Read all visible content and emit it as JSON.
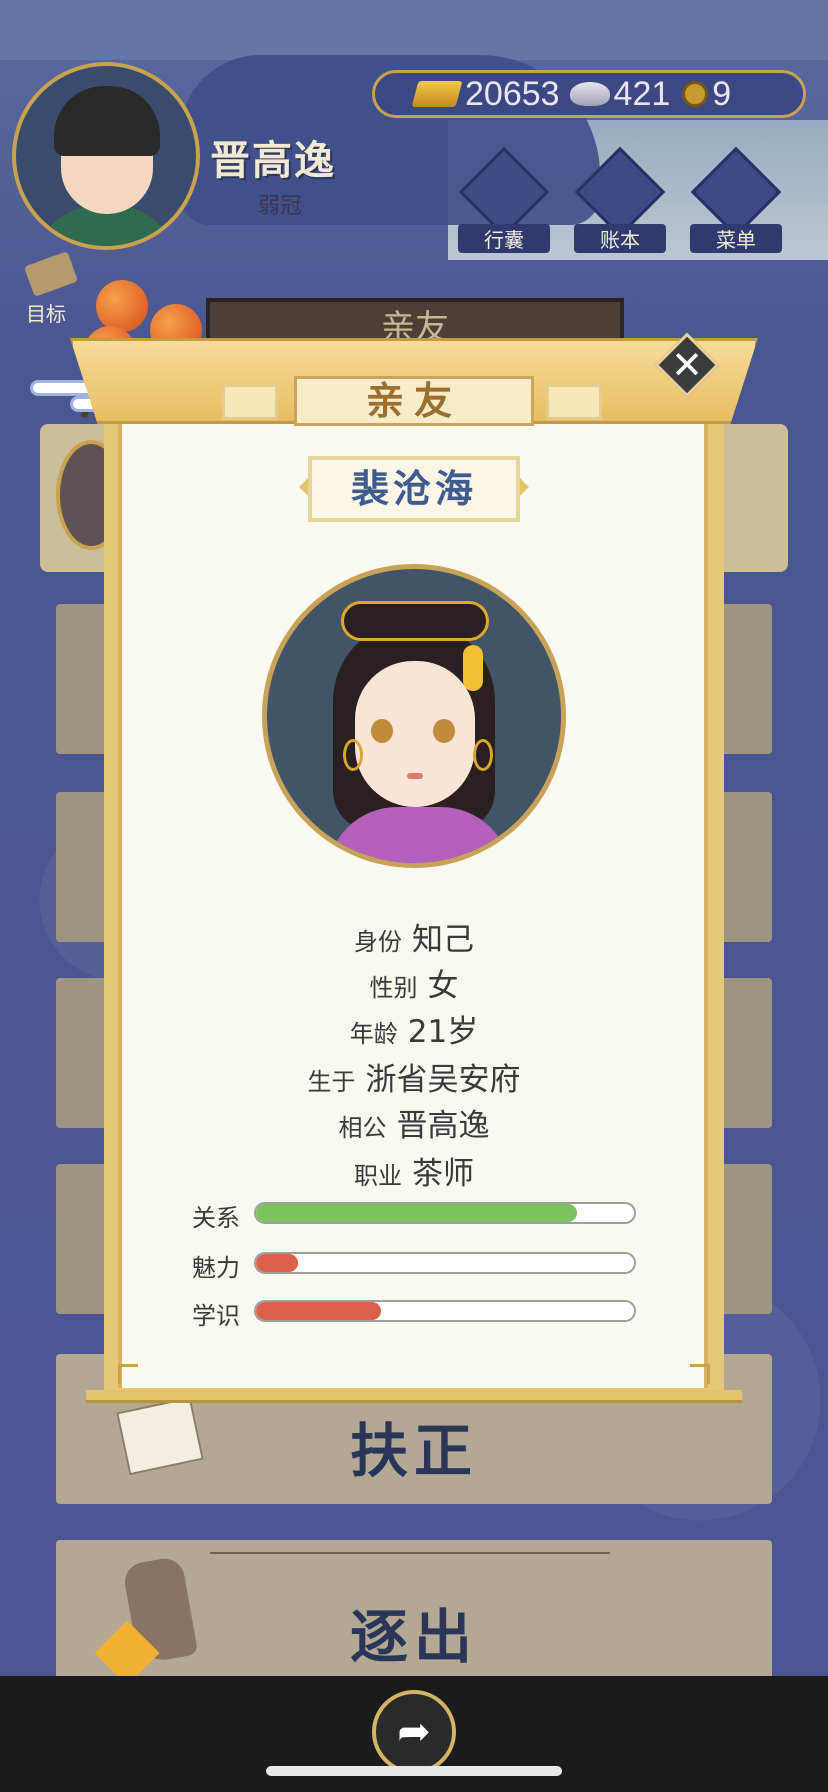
{
  "header": {
    "player_name": "晋高逸",
    "player_age_title": "弱冠",
    "currency": {
      "gold": "20653",
      "silver": "421",
      "coins": "9"
    },
    "menu": [
      {
        "label": "行囊",
        "icon": "bag-icon"
      },
      {
        "label": "账本",
        "icon": "ledger-icon"
      },
      {
        "label": "菜单",
        "icon": "more-icon"
      }
    ],
    "goal_label": "目标"
  },
  "background": {
    "section_title": "亲友",
    "action_promote": "扶正",
    "action_expel": "逐出"
  },
  "modal": {
    "title": "亲友",
    "close_symbol": "✕",
    "character_name": "裴沧海",
    "info": [
      {
        "key": "身份",
        "value": "知己"
      },
      {
        "key": "性别",
        "value": "女"
      },
      {
        "key": "年龄",
        "value": "21岁"
      },
      {
        "key": "生于",
        "value": "浙省吴安府"
      },
      {
        "key": "相公",
        "value": "晋高逸"
      },
      {
        "key": "职业",
        "value": "茶师"
      }
    ],
    "stats": [
      {
        "label": "关系",
        "fraction": 0.85,
        "color": "#7dc25d"
      },
      {
        "label": "魅力",
        "fraction": 0.11,
        "color": "#dc604a"
      },
      {
        "label": "学识",
        "fraction": 0.33,
        "color": "#dc604a"
      }
    ]
  },
  "bottom": {
    "share_icon": "share-icon",
    "share_symbol": "➦"
  }
}
